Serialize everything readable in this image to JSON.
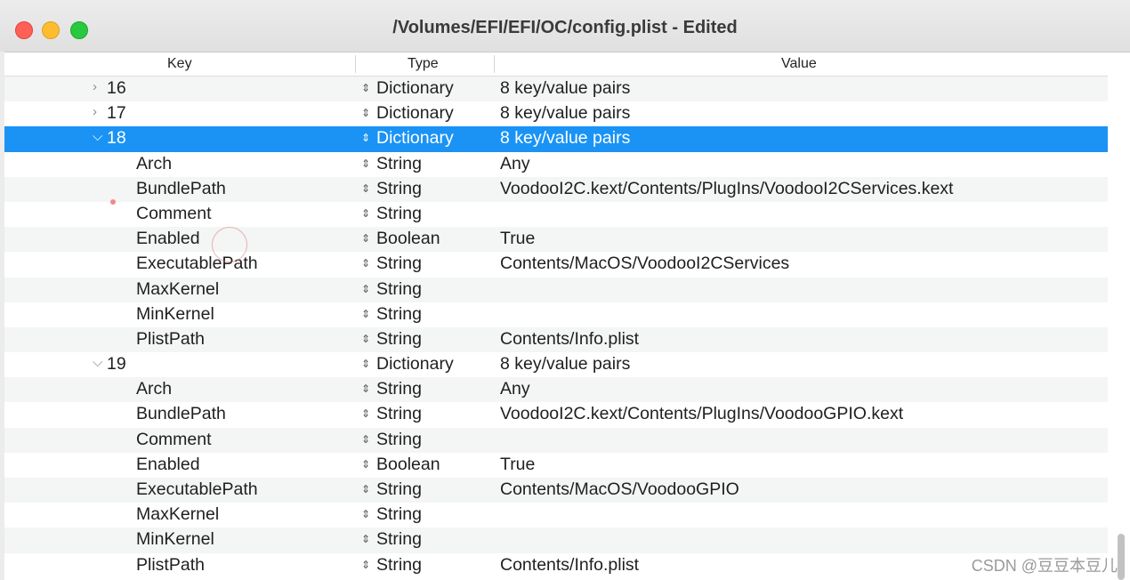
{
  "window": {
    "title": "/Volumes/EFI/EFI/OC/config.plist - Edited"
  },
  "columns": {
    "key": "Key",
    "type": "Type",
    "value": "Value"
  },
  "rows": [
    {
      "key": "16",
      "type": "Dictionary",
      "value": "8 key/value pairs",
      "level": "parent",
      "expanded": false,
      "selected": false
    },
    {
      "key": "17",
      "type": "Dictionary",
      "value": "8 key/value pairs",
      "level": "parent",
      "expanded": false,
      "selected": false
    },
    {
      "key": "18",
      "type": "Dictionary",
      "value": "8 key/value pairs",
      "level": "parent",
      "expanded": true,
      "selected": true
    },
    {
      "key": "Arch",
      "type": "String",
      "value": "Any",
      "level": "child"
    },
    {
      "key": "BundlePath",
      "type": "String",
      "value": "VoodooI2C.kext/Contents/PlugIns/VoodooI2CServices.kext",
      "level": "child"
    },
    {
      "key": "Comment",
      "type": "String",
      "value": "",
      "level": "child"
    },
    {
      "key": "Enabled",
      "type": "Boolean",
      "value": "True",
      "level": "child"
    },
    {
      "key": "ExecutablePath",
      "type": "String",
      "value": "Contents/MacOS/VoodooI2CServices",
      "level": "child"
    },
    {
      "key": "MaxKernel",
      "type": "String",
      "value": "",
      "level": "child"
    },
    {
      "key": "MinKernel",
      "type": "String",
      "value": "",
      "level": "child"
    },
    {
      "key": "PlistPath",
      "type": "String",
      "value": "Contents/Info.plist",
      "level": "child"
    },
    {
      "key": "19",
      "type": "Dictionary",
      "value": "8 key/value pairs",
      "level": "parent",
      "expanded": true,
      "selected": false
    },
    {
      "key": "Arch",
      "type": "String",
      "value": "Any",
      "level": "child"
    },
    {
      "key": "BundlePath",
      "type": "String",
      "value": "VoodooI2C.kext/Contents/PlugIns/VoodooGPIO.kext",
      "level": "child"
    },
    {
      "key": "Comment",
      "type": "String",
      "value": "",
      "level": "child"
    },
    {
      "key": "Enabled",
      "type": "Boolean",
      "value": "True",
      "level": "child"
    },
    {
      "key": "ExecutablePath",
      "type": "String",
      "value": "Contents/MacOS/VoodooGPIO",
      "level": "child"
    },
    {
      "key": "MaxKernel",
      "type": "String",
      "value": "",
      "level": "child"
    },
    {
      "key": "MinKernel",
      "type": "String",
      "value": "",
      "level": "child"
    },
    {
      "key": "PlistPath",
      "type": "String",
      "value": "Contents/Info.plist",
      "level": "child"
    }
  ],
  "icons": {
    "collapsed": "chevron-right-icon",
    "expanded": "chevron-down-icon",
    "type_popup": "updown-arrows-icon"
  },
  "colors": {
    "selection": "#1a93f5",
    "alt_row": "#f4f5f5"
  },
  "watermark": "CSDN @豆豆本豆儿"
}
